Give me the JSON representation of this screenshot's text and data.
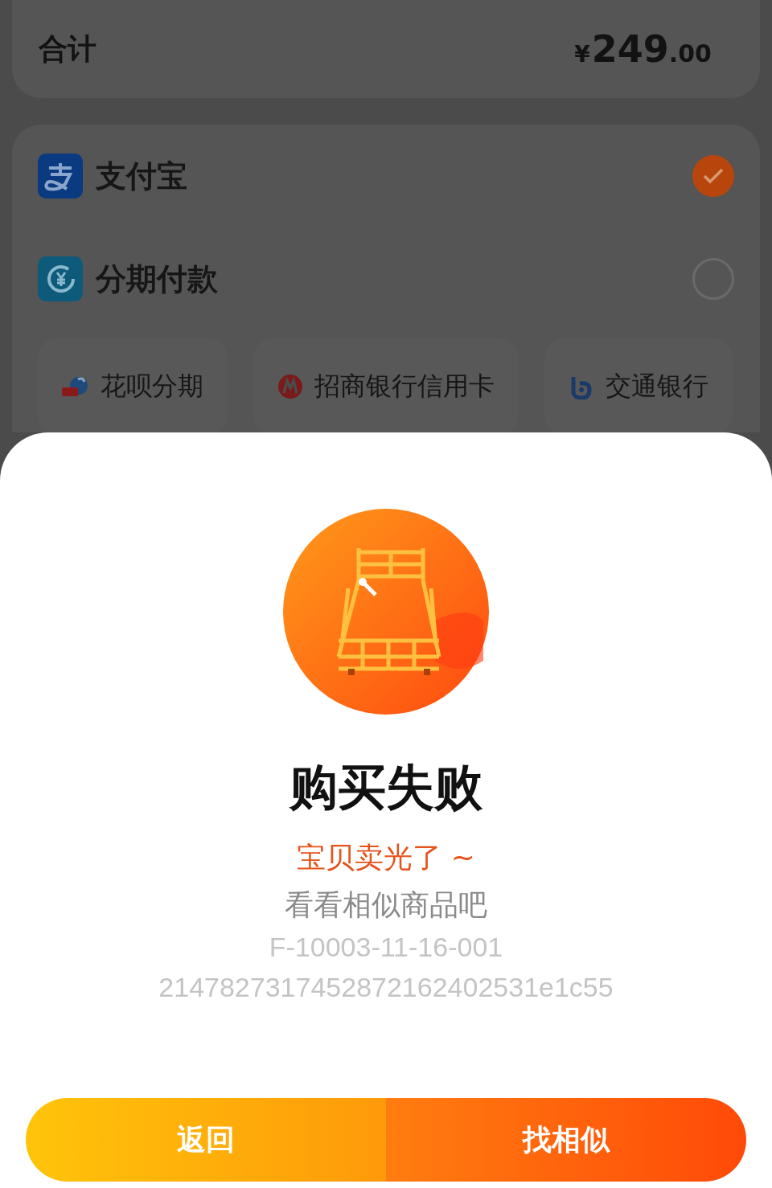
{
  "summary": {
    "label": "合计",
    "currency": "¥",
    "amount_integer": "249",
    "amount_decimal": ".00"
  },
  "payment_methods": [
    {
      "kind": "alipay",
      "label": "支付宝",
      "selected": true
    },
    {
      "kind": "installment",
      "label": "分期付款",
      "selected": false
    }
  ],
  "installment_options": [
    {
      "kind": "huabei",
      "label": "花呗分期"
    },
    {
      "kind": "cmb",
      "label": "招商银行信用卡"
    },
    {
      "kind": "bocom",
      "label": "交通银行"
    }
  ],
  "dialog": {
    "title": "购买失败",
    "message": "宝贝卖光了 ~",
    "hint": "看看相似商品吧",
    "codes": [
      "F-10003-11-16-001",
      "2147827317452872162402531e1c55"
    ],
    "buttons": [
      {
        "kind": "back",
        "label": "返回"
      },
      {
        "kind": "similar",
        "label": "找相似"
      }
    ]
  }
}
